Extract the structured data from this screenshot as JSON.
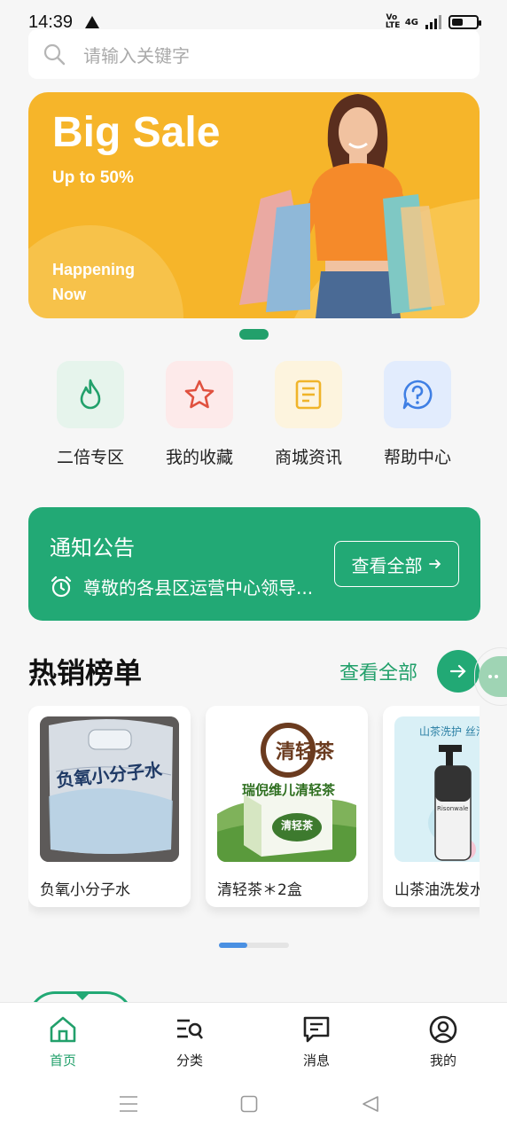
{
  "status": {
    "time": "14:39",
    "network_tag": "Vo LTE",
    "net_type": "4G"
  },
  "search": {
    "placeholder": "请输入关键字"
  },
  "banner": {
    "title": "Big Sale",
    "subtitle": "Up to 50%",
    "tagline": "Happening Now"
  },
  "quick_links": [
    {
      "label": "二倍专区",
      "icon": "flame-icon",
      "bg": "#e6f4ec",
      "color": "#22a06b"
    },
    {
      "label": "我的收藏",
      "icon": "star-icon",
      "bg": "#fdeaea",
      "color": "#e0513f"
    },
    {
      "label": "商城资讯",
      "icon": "news-icon",
      "bg": "#fdf4de",
      "color": "#f0b429"
    },
    {
      "label": "帮助中心",
      "icon": "help-icon",
      "bg": "#e2ecfd",
      "color": "#3f7fe4"
    }
  ],
  "notice": {
    "title": "通知公告",
    "text": "尊敬的各县区运营中心领导...",
    "button": "查看全部"
  },
  "hot": {
    "title": "热销榜单",
    "more": "查看全部"
  },
  "products": [
    {
      "name": "负氧小分子水",
      "image_text": "负氧小分子水"
    },
    {
      "name": "清轻茶＊2盒",
      "image_text_top": "瑞倪维儿清轻茶",
      "image_seal": "清轻茶",
      "image_box": "清轻茶"
    },
    {
      "name": "山茶油洗发水",
      "image_text_top": "山茶洗护  丝滑",
      "image_bottle": "Risonwale"
    }
  ],
  "tabs": [
    {
      "label": "首页",
      "icon": "home-icon",
      "active": true
    },
    {
      "label": "分类",
      "icon": "category-icon",
      "active": false
    },
    {
      "label": "消息",
      "icon": "message-icon",
      "active": false
    },
    {
      "label": "我的",
      "icon": "profile-icon",
      "active": false
    }
  ],
  "colors": {
    "accent": "#22a975",
    "banner": "#f6b52a"
  }
}
